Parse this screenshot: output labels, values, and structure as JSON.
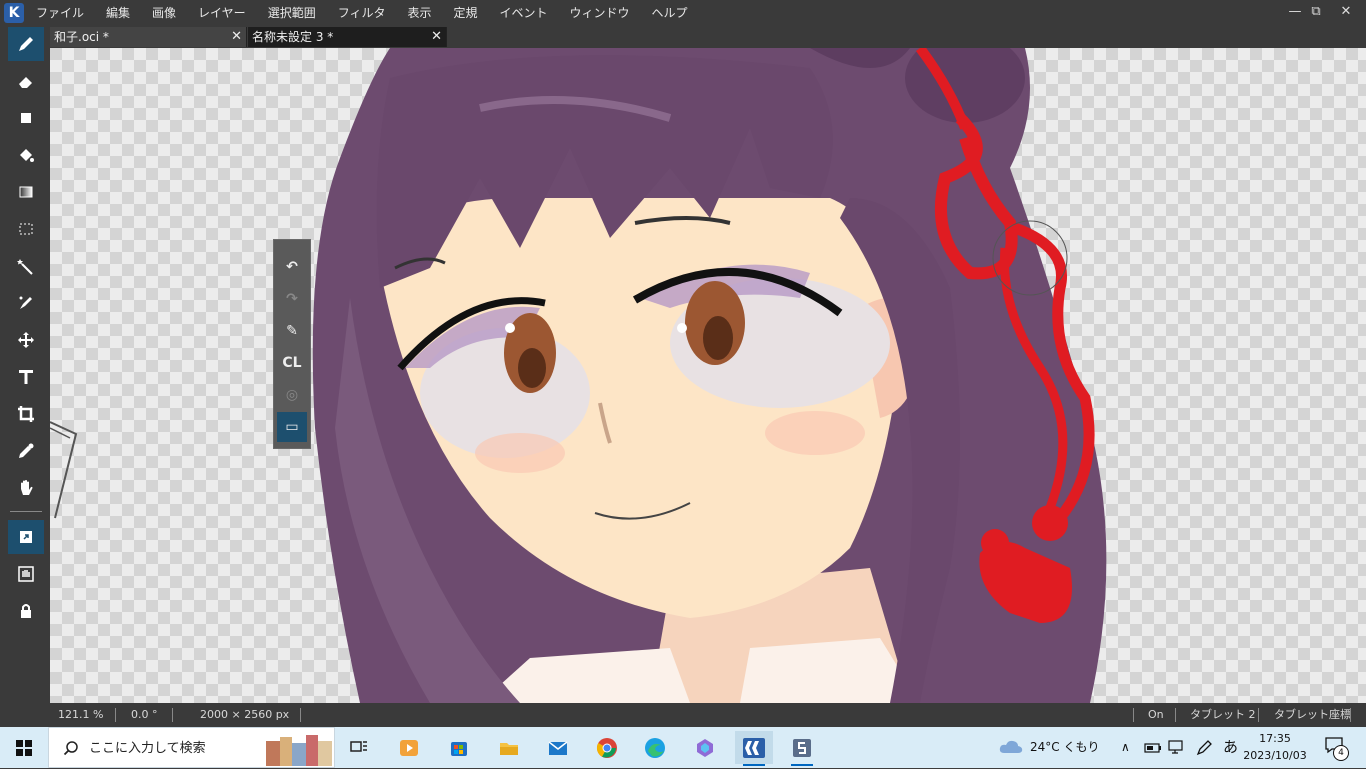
{
  "app": {
    "logo": "K"
  },
  "menu": [
    "ファイル",
    "編集",
    "画像",
    "レイヤー",
    "選択範囲",
    "フィルタ",
    "表示",
    "定規",
    "イベント",
    "ウィンドウ",
    "ヘルプ"
  ],
  "window_controls": {
    "minimize": "—",
    "restore": "⧉",
    "close": "✕"
  },
  "tabs": [
    {
      "label": "和子.oci *",
      "close": "✕"
    },
    {
      "label": "名称未設定 3 *",
      "close": "✕"
    }
  ],
  "tools": [
    "brush-icon",
    "eraser-icon",
    "rectangle-icon",
    "fill-icon",
    "gradient-icon",
    "rect-select-icon",
    "magic-wand-icon",
    "select-brush-icon",
    "move-icon",
    "text-icon",
    "crop-icon",
    "eyedropper-icon",
    "hand-icon",
    "pen-mode-icon",
    "touch-icon",
    "lock-icon"
  ],
  "palette": {
    "undo": "↶",
    "redo": "↷",
    "pen": "✎",
    "clear": "CL",
    "target": "◎",
    "window": "▭"
  },
  "status": {
    "zoom": "121.1 %",
    "angle": "0.0 °",
    "size": "2000 × 2560 px",
    "pen_state": "On",
    "tablet": "タブレット 2",
    "tablet_coords": "タブレット座標"
  },
  "taskbar": {
    "search_placeholder": "ここに入力して検索",
    "weather": "24°C くもり",
    "time": "17:35",
    "date": "2023/10/03",
    "notifications": "4",
    "ime": "あ"
  },
  "colors": {
    "accent": "#1d4f6e",
    "hair": "#6b4a6e",
    "ribbon": "#e01c22",
    "skin": "#fde5c6"
  }
}
